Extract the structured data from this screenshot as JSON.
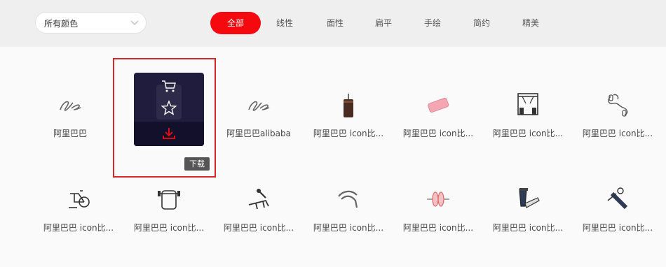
{
  "filter": {
    "color_select_value": "所有颜色"
  },
  "tabs": [
    {
      "label": "全部",
      "active": true
    },
    {
      "label": "线性",
      "active": false
    },
    {
      "label": "面性",
      "active": false
    },
    {
      "label": "扁平",
      "active": false
    },
    {
      "label": "手绘",
      "active": false
    },
    {
      "label": "简约",
      "active": false
    },
    {
      "label": "精美",
      "active": false
    }
  ],
  "hover": {
    "tooltip": "下载",
    "actions": [
      "cart-icon",
      "star-icon",
      "download-icon"
    ]
  },
  "rows": [
    [
      {
        "label": "阿里巴巴",
        "icon": "alibaba-logo-icon"
      },
      {
        "label": "",
        "icon": "hover-card"
      },
      {
        "label": "阿里巴巴alibaba",
        "icon": "alibaba-logo-icon"
      },
      {
        "label": "阿里巴巴 icon比...",
        "icon": "punching-bag-icon"
      },
      {
        "label": "阿里巴巴 icon比...",
        "icon": "eraser-icon"
      },
      {
        "label": "阿里巴巴 icon比...",
        "icon": "gym-machine-icon"
      },
      {
        "label": "阿里巴巴 icon比...",
        "icon": "jump-rope-icon"
      }
    ],
    [
      {
        "label": "阿里巴巴 icon比...",
        "icon": "exercise-bike-icon"
      },
      {
        "label": "阿里巴巴 icon比...",
        "icon": "squat-rack-icon"
      },
      {
        "label": "阿里巴巴 icon比...",
        "icon": "bench-press-icon"
      },
      {
        "label": "阿里巴巴 icon比...",
        "icon": "hand-grip-icon"
      },
      {
        "label": "阿里巴巴 icon比...",
        "icon": "barbell-plate-icon"
      },
      {
        "label": "阿里巴巴 icon比...",
        "icon": "treadmill-icon"
      },
      {
        "label": "阿里巴巴 icon比...",
        "icon": "foam-roller-icon"
      }
    ]
  ],
  "colors": {
    "accent": "#f5090f",
    "hover_frame": "#d7262d",
    "card_bg": "#1f1c3d"
  }
}
